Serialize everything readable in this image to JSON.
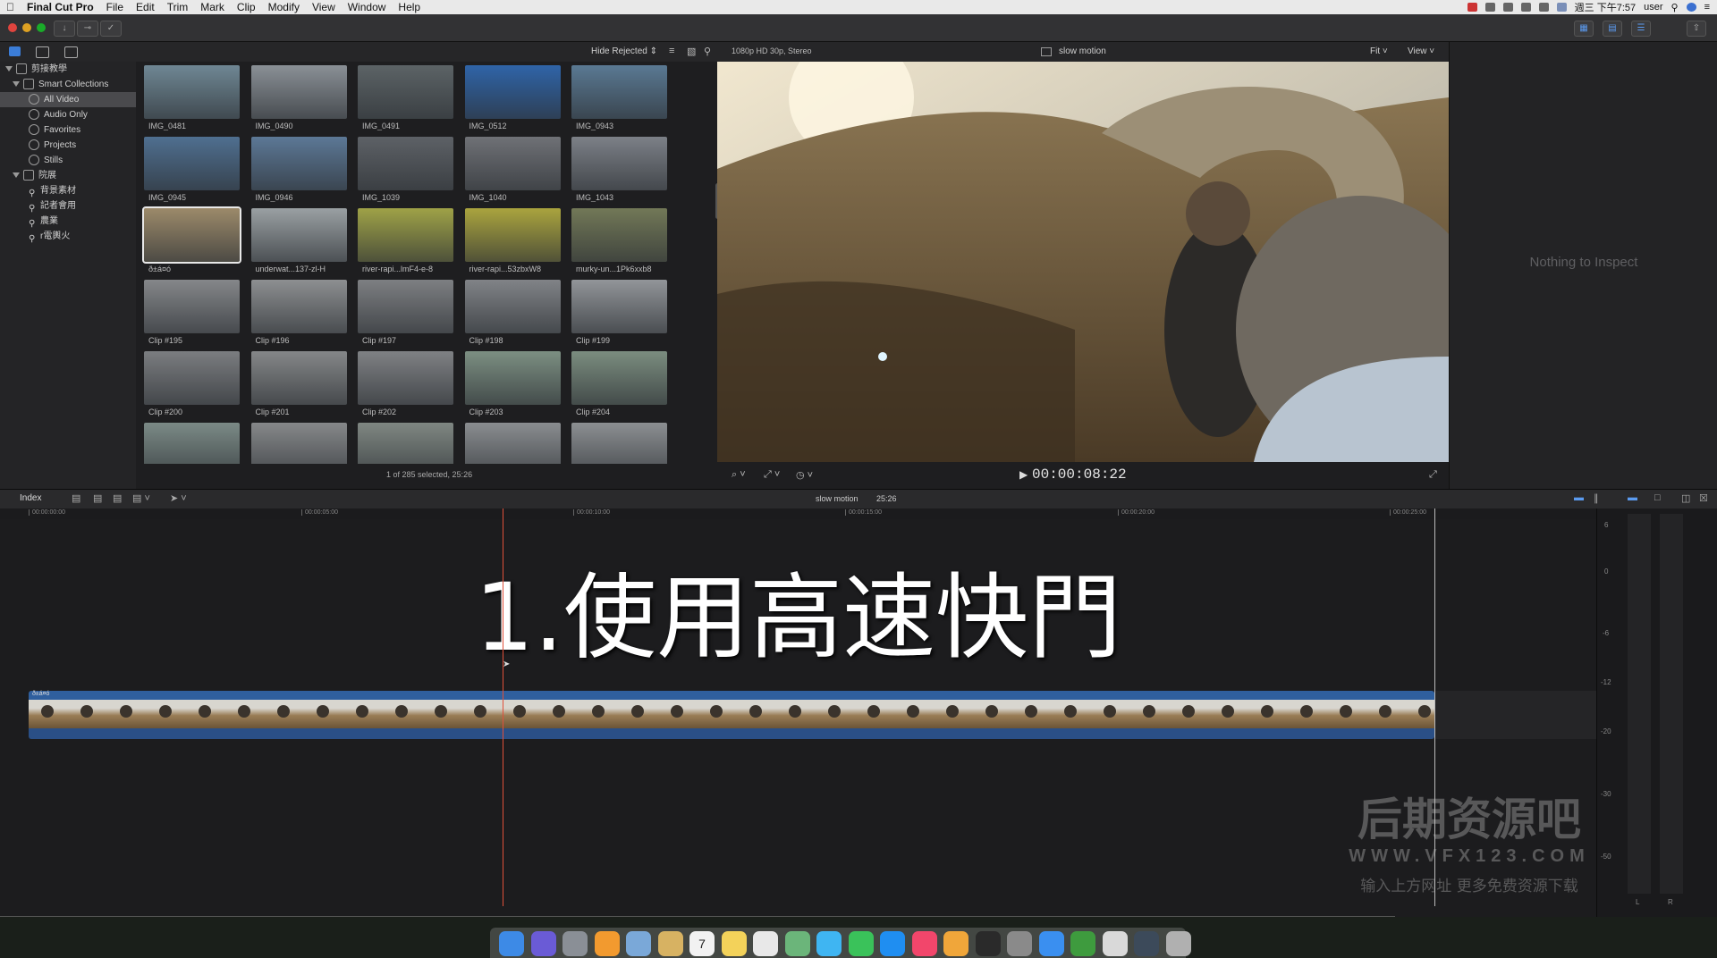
{
  "menubar": {
    "app_name": "Final Cut Pro",
    "items": [
      "File",
      "Edit",
      "Trim",
      "Mark",
      "Clip",
      "Modify",
      "View",
      "Window",
      "Help"
    ],
    "datetime": "週三 下午7:57",
    "user": "user"
  },
  "library": {
    "name": "剪接教學",
    "smart_collections_label": "Smart Collections",
    "smart_items": [
      "All Video",
      "Audio Only",
      "Favorites",
      "Projects",
      "Stills"
    ],
    "event_name": "院展",
    "keywords": [
      "背景素材",
      "記者會用",
      "農業",
      "r電輿火"
    ]
  },
  "browser": {
    "filter": "Hide Rejected",
    "status": "1 of 285 selected, 25:26",
    "clips": [
      {
        "label": "IMG_0481",
        "color": "#6f8794"
      },
      {
        "label": "IMG_0490",
        "color": "#8a9096"
      },
      {
        "label": "IMG_0491",
        "color": "#5c6366"
      },
      {
        "label": "IMG_0512",
        "color": "#2f64a8"
      },
      {
        "label": "IMG_0943",
        "color": "#5a7993"
      },
      {
        "label": "IMG_0945",
        "color": "#4f6f90"
      },
      {
        "label": "IMG_0946",
        "color": "#5c7896"
      },
      {
        "label": "IMG_1039",
        "color": "#5d6166"
      },
      {
        "label": "IMG_1040",
        "color": "#6f7176"
      },
      {
        "label": "IMG_1043",
        "color": "#7c8087"
      },
      {
        "label": "ð±á¤ó",
        "color": "#9c8a6a"
      },
      {
        "label": "underwat...137-zl-H",
        "color": "#9aa0a3"
      },
      {
        "label": "river-rapi...lmF4-e-8",
        "color": "#9fa247"
      },
      {
        "label": "river-rapi...53zbxW8",
        "color": "#aaa43e"
      },
      {
        "label": "murky-un...1Pk6xxb8",
        "color": "#727857"
      },
      {
        "label": "Clip #195",
        "color": "#85878a"
      },
      {
        "label": "Clip #196",
        "color": "#8d8f91"
      },
      {
        "label": "Clip #197",
        "color": "#7d7f82"
      },
      {
        "label": "Clip #198",
        "color": "#818387"
      },
      {
        "label": "Clip #199",
        "color": "#929599"
      },
      {
        "label": "Clip #200",
        "color": "#7b7d80"
      },
      {
        "label": "Clip #201",
        "color": "#858789"
      },
      {
        "label": "Clip #202",
        "color": "#7f8184"
      },
      {
        "label": "Clip #203",
        "color": "#7c8f82"
      },
      {
        "label": "Clip #204",
        "color": "#7b8d7f"
      },
      {
        "label": "",
        "color": "#7b8a86"
      },
      {
        "label": "",
        "color": "#86888a"
      },
      {
        "label": "",
        "color": "#7f8782"
      },
      {
        "label": "",
        "color": "#8a8d90"
      },
      {
        "label": "",
        "color": "#8c8f92"
      }
    ]
  },
  "viewer": {
    "format": "1080p HD 30p, Stereo",
    "project_name": "slow motion",
    "zoom": "Fit",
    "view_menu": "View",
    "timecode": "00:00:08:22"
  },
  "inspector": {
    "empty_text": "Nothing to Inspect"
  },
  "timeline": {
    "index_label": "Index",
    "project_name": "slow motion",
    "duration": "25:26",
    "ruler_ticks": [
      "00:00:00:00",
      "00:00:05:00",
      "00:00:10:00",
      "00:00:15:00",
      "00:00:20:00",
      "00:00:25:00"
    ],
    "caption": "1.使用高速快門",
    "clip_name": "ð±á¤ó"
  },
  "meters": {
    "scale": [
      "6",
      "0",
      "-6",
      "-12",
      "-20",
      "-30",
      "-50"
    ],
    "channels": [
      "L",
      "R"
    ]
  },
  "watermark": {
    "title": "后期资源吧",
    "url": "WWW.VFX123.COM",
    "tagline": "输入上方网址 更多免费资源下载"
  },
  "colors": {
    "accent_blue": "#3b7dd8",
    "playhead": "#e0503a",
    "clip_blue": "#2f5f9e"
  },
  "dock": {
    "apps": [
      "finder-icon",
      "siri-icon",
      "launchpad-icon",
      "books-icon",
      "preview-icon",
      "notes-icon",
      "calendar-icon",
      "stickies-icon",
      "reminders-icon",
      "maps-icon",
      "messages-icon",
      "facetime-icon",
      "app-store-icon",
      "music-icon",
      "photos-icon",
      "final-cut-icon",
      "system-prefs-icon",
      "safari-icon",
      "compressor-icon",
      "screenshot-icon",
      "folder-icon",
      "trash-icon"
    ],
    "calendar_day": "7"
  }
}
